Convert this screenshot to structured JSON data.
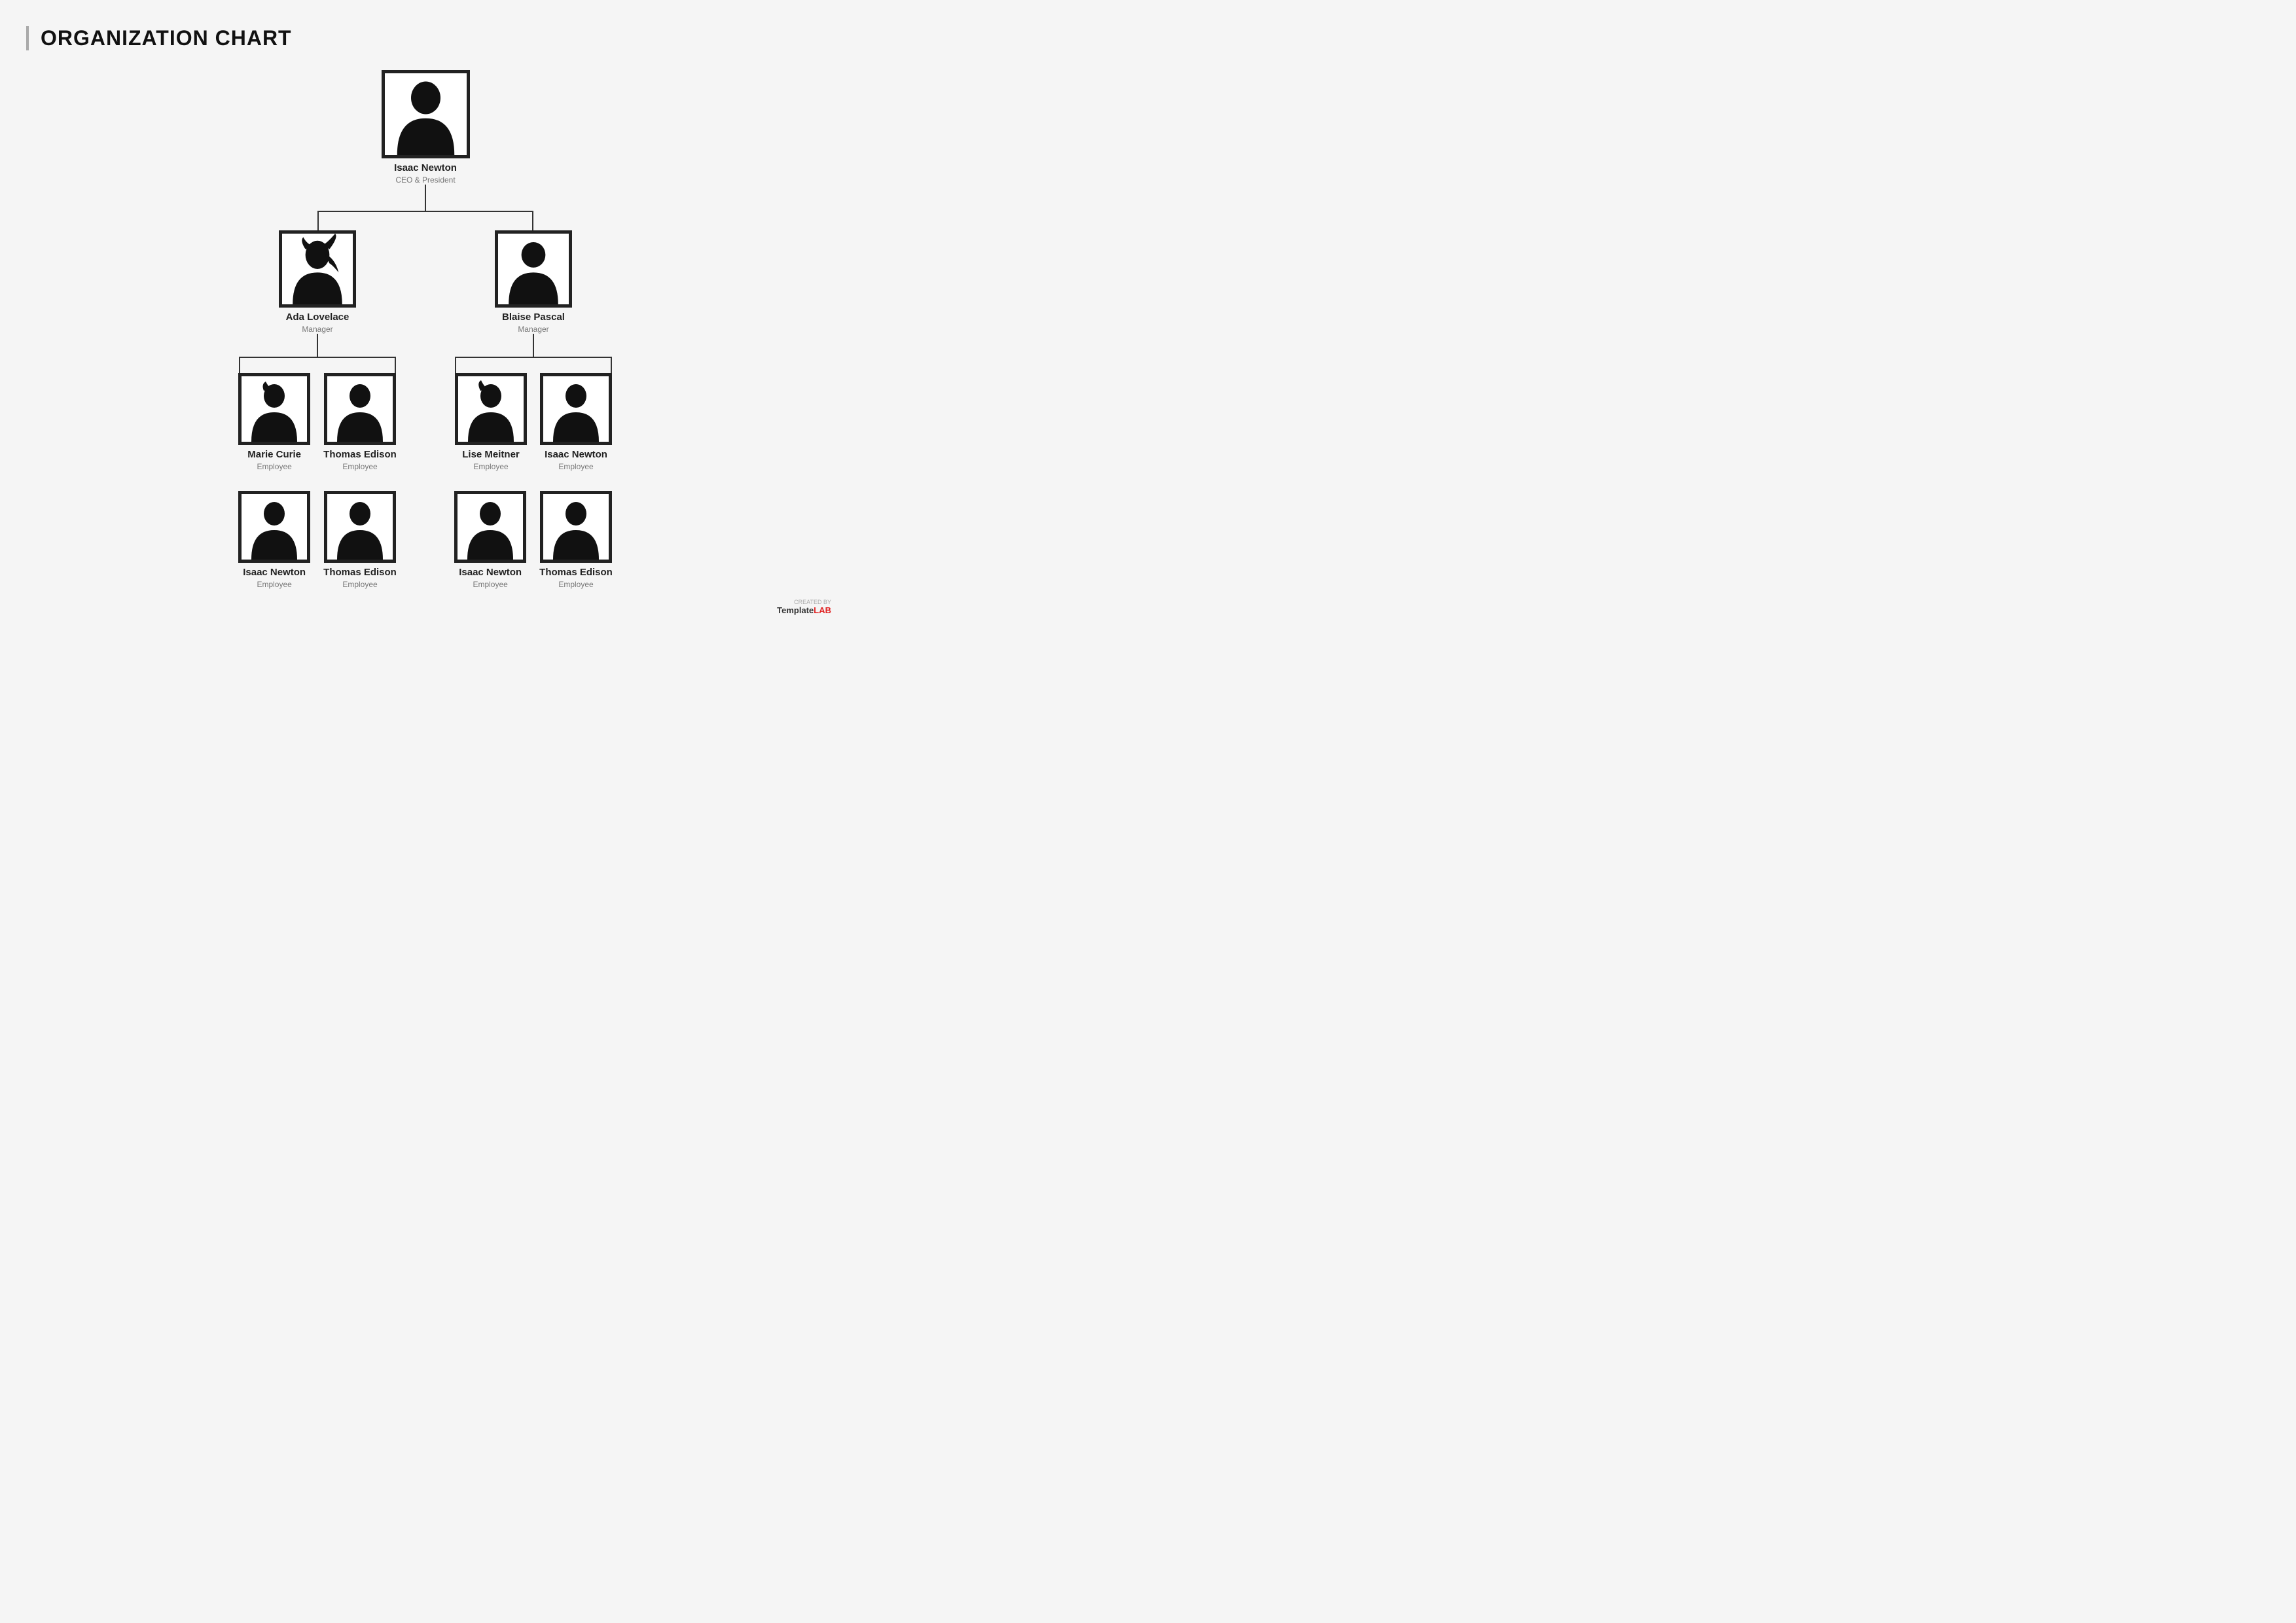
{
  "title": "ORGANIZATION CHART",
  "ceo": {
    "name": "Isaac Newton",
    "role": "CEO & President"
  },
  "managers": [
    {
      "name": "Ada Lovelace",
      "role": "Manager"
    },
    {
      "name": "Blaise Pascal",
      "role": "Manager"
    }
  ],
  "employees_row1": [
    {
      "name": "Marie Curie",
      "role": "Employee",
      "gender": "female"
    },
    {
      "name": "Thomas Edison",
      "role": "Employee",
      "gender": "male"
    },
    {
      "name": "Lise Meitner",
      "role": "Employee",
      "gender": "female"
    },
    {
      "name": "Isaac Newton",
      "role": "Employee",
      "gender": "male"
    }
  ],
  "employees_row2": [
    {
      "name": "Isaac Newton",
      "role": "Employee",
      "gender": "male"
    },
    {
      "name": "Thomas Edison",
      "role": "Employee",
      "gender": "male"
    },
    {
      "name": "Isaac Newton",
      "role": "Employee",
      "gender": "male"
    },
    {
      "name": "Thomas Edison",
      "role": "Employee",
      "gender": "male"
    }
  ],
  "watermark": {
    "created_by": "CREATED BY",
    "brand_1": "Template",
    "brand_2": "LAB"
  }
}
